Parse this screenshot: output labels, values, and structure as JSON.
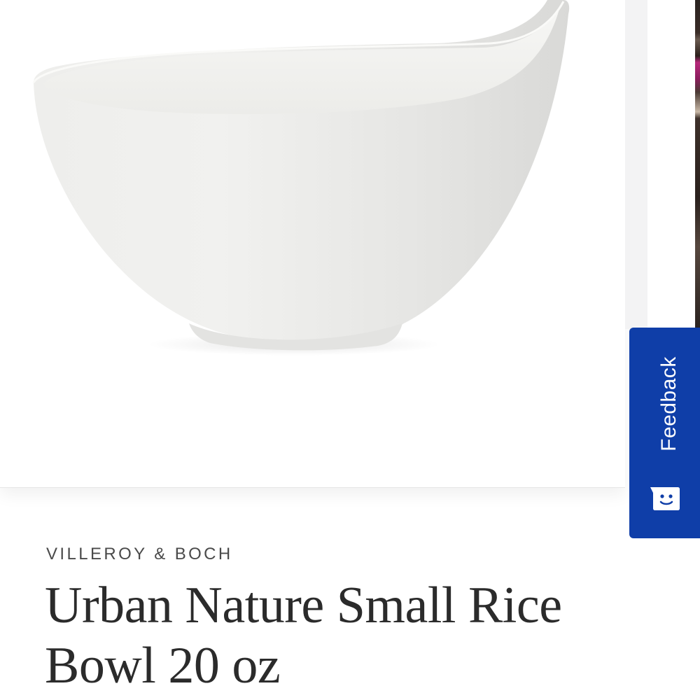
{
  "product": {
    "brand": "VILLEROY & BOCH",
    "title": "Urban Nature Small Rice Bowl 20 oz",
    "image_icon": "white-bowl-image"
  },
  "feedback_tab": {
    "label": "Feedback",
    "icon": "smiley-chat-icon",
    "color": "#0f3ea8"
  },
  "colors": {
    "background": "#ffffff",
    "text_primary": "#2b2b2b",
    "text_brand": "#4a4a4a"
  }
}
